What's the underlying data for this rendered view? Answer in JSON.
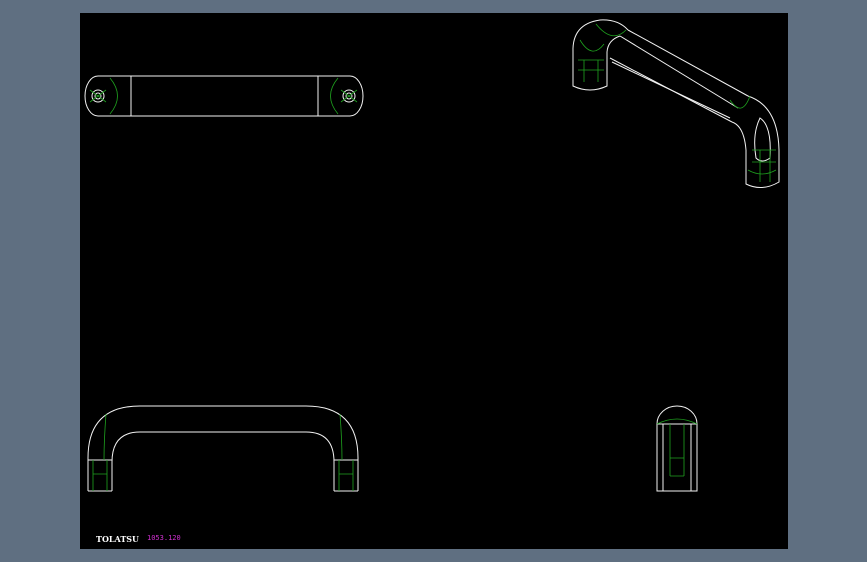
{
  "viewport": {
    "background_color": "#5f6f81",
    "drawing_area_color": "#000000"
  },
  "drawing": {
    "line_color": "#f2f2f2",
    "hidden_line_color": "#1fa31f",
    "views": [
      "top-view",
      "isometric-view",
      "front-view",
      "side-view"
    ]
  },
  "title_block": {
    "brand": "TOLATSU",
    "brand_color": "#ffffff",
    "code": "1053.120",
    "code_color": "#d030d0"
  }
}
